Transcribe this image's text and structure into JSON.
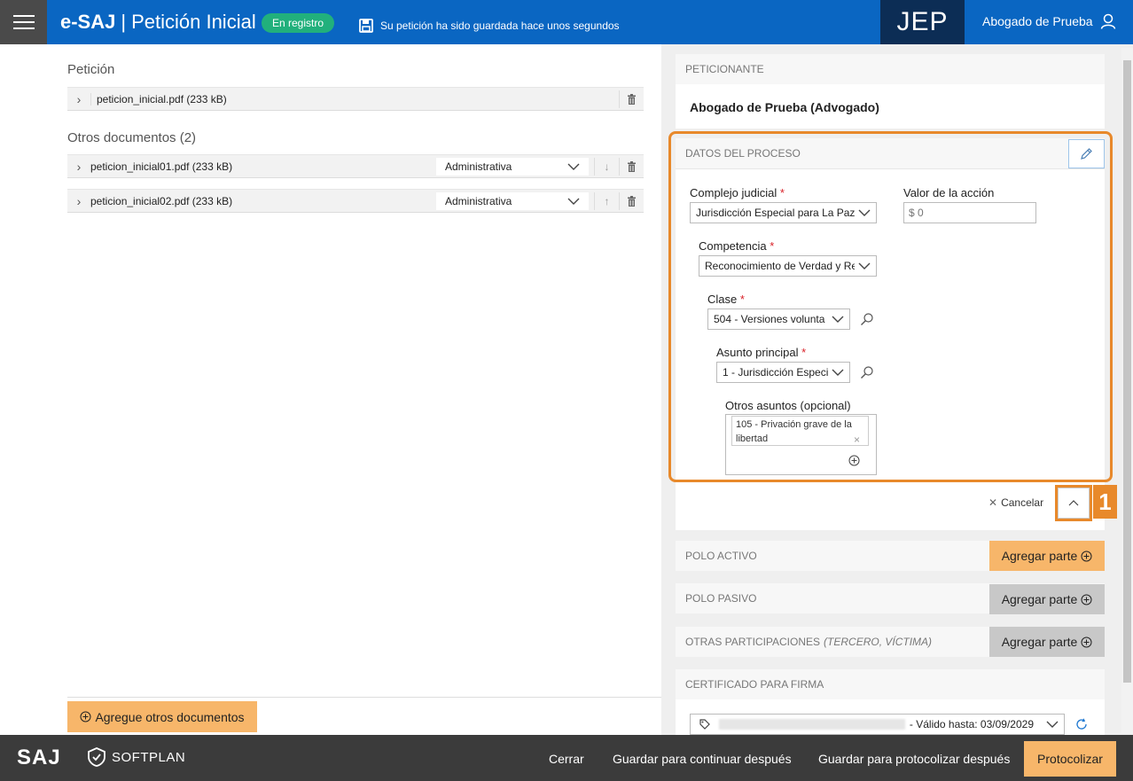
{
  "header": {
    "app_name": "e-SAJ",
    "separator": "|",
    "page_title": "Petición Inicial",
    "status_badge": "En registro",
    "save_note": "Su petición ha sido guardada hace unos segundos",
    "org_logo": "JEP",
    "user_name": "Abogado de Prueba",
    "colors": {
      "bar": "#0a66c2",
      "badge": "#21b07c",
      "org": "#0c2d55"
    }
  },
  "left": {
    "peticion_title": "Petición",
    "main_document": "peticion_inicial.pdf (233 kB)",
    "others_title": "Otros documentos (2)",
    "other_documents": [
      {
        "name": "peticion_inicial01.pdf (233 kB)",
        "type": "Administrativa"
      },
      {
        "name": "peticion_inicial02.pdf (233 kB)",
        "type": "Administrativa"
      }
    ],
    "add_docs_label": "Agregue otros documentos"
  },
  "right": {
    "peticionante_header": "PETICIONANTE",
    "peticionante_name": "Abogado de Prueba (Advogado)",
    "datos_header": "DATOS DEL PROCESO",
    "complejo_label": "Complejo judicial",
    "complejo_value": "Jurisdicción Especial para La Paz",
    "valor_label": "Valor de la acción",
    "valor_placeholder": "$ 0",
    "competencia_label": "Competencia",
    "competencia_value": "Reconocimiento de Verdad y Re",
    "clase_label": "Clase",
    "clase_value": "504 - Versiones volunta",
    "asunto_label": "Asunto principal",
    "asunto_value": "1 - Jurisdicción Especi",
    "otros_label": "Otros asuntos (opcional)",
    "otros_tag": "105 - Privación grave de la libertad",
    "cancel_label": "Cancelar",
    "callout_number": "1",
    "polo_activo": "POLO ACTIVO",
    "polo_pasivo": "POLO PASIVO",
    "otras_part": "OTRAS PARTICIPACIONES",
    "otras_part_sub": "(TERCERO, VÍCTIMA)",
    "add_party_label": "Agregar parte",
    "cert_header": "CERTIFICADO PARA FIRMA",
    "cert_valid": "- Válido hasta: 03/09/2029"
  },
  "footer": {
    "logo_saj": "SAJ",
    "logo_softplan": "SOFTPLAN",
    "cerrar": "Cerrar",
    "guardar_continuar": "Guardar para continuar después",
    "guardar_protocolizar": "Guardar para protocolizar después",
    "protocolizar": "Protocolizar",
    "colors": {
      "bar": "#3b3b3b",
      "primary": "#f7b66a",
      "highlight": "#e8892b"
    }
  }
}
